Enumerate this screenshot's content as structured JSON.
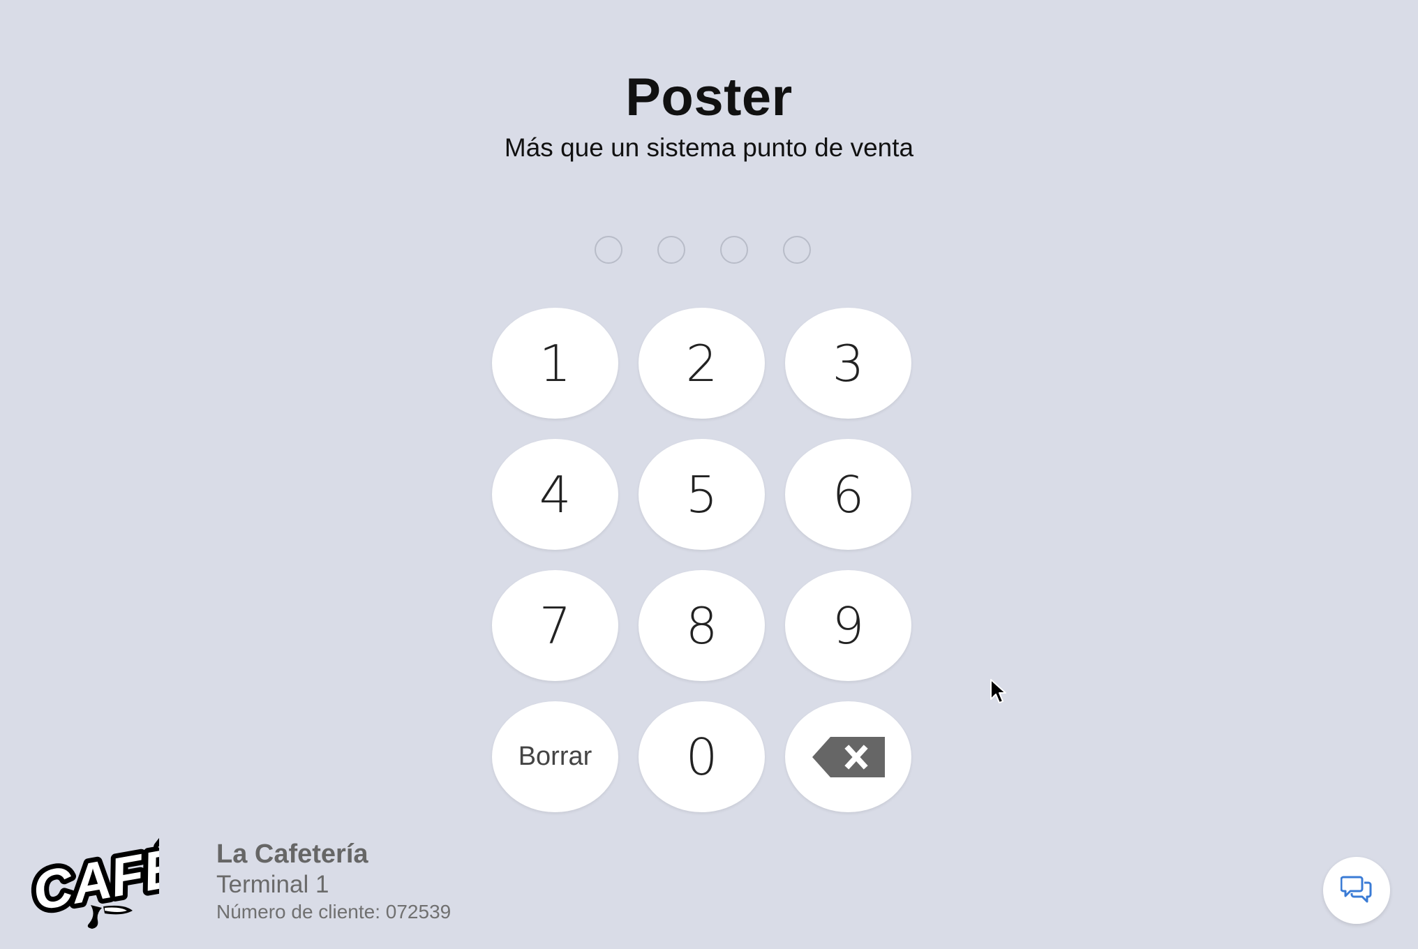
{
  "header": {
    "title": "Poster",
    "subtitle": "Más que un sistema punto de venta"
  },
  "pin": {
    "length": 4,
    "filled": 0
  },
  "keypad": {
    "keys": [
      {
        "label": "1"
      },
      {
        "label": "2"
      },
      {
        "label": "3"
      },
      {
        "label": "4"
      },
      {
        "label": "5"
      },
      {
        "label": "6"
      },
      {
        "label": "7"
      },
      {
        "label": "8"
      },
      {
        "label": "9"
      },
      {
        "label": "Borrar"
      },
      {
        "label": "0"
      },
      {
        "icon": "backspace-icon"
      }
    ]
  },
  "business": {
    "logo_text": "CAFÉ",
    "name": "La Cafetería",
    "terminal": "Terminal 1",
    "client_number": "Número de cliente: 072539"
  },
  "chat": {
    "icon": "chat-bubbles-icon",
    "color": "#3a7bd5"
  },
  "colors": {
    "background": "#d9dce7",
    "key_background": "#ffffff",
    "backspace_icon": "#666666"
  }
}
